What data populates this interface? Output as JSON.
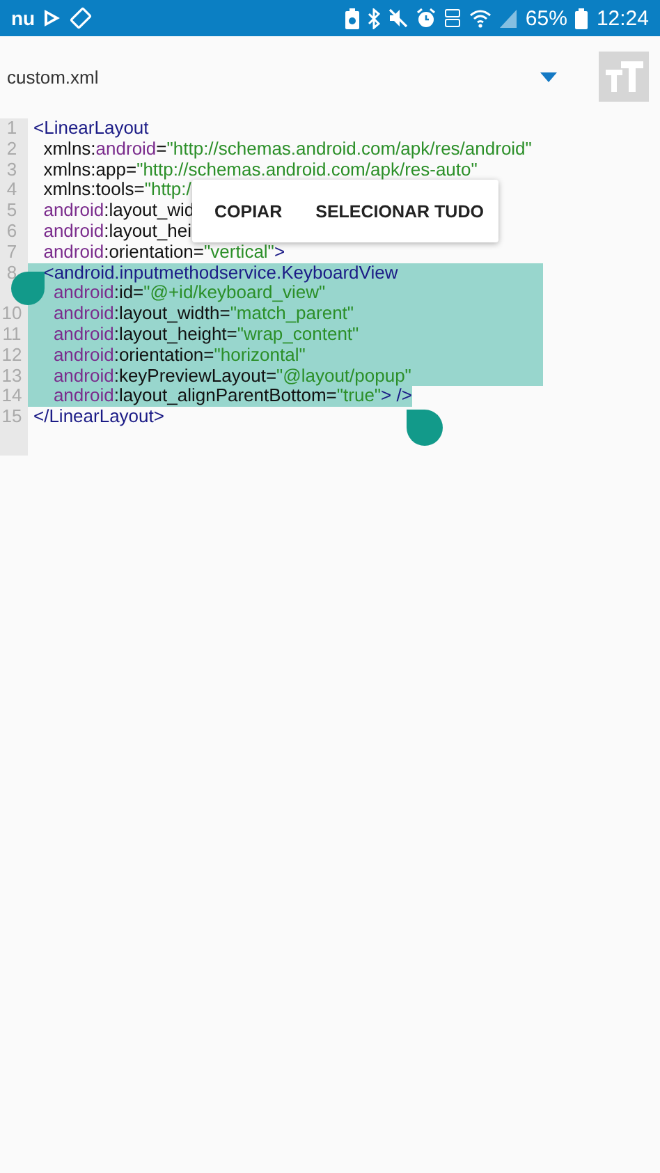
{
  "status_bar": {
    "app_badge": "nu",
    "battery_percent": "65%",
    "time": "12:24"
  },
  "toolbar": {
    "file_name": "custom.xml"
  },
  "editor": {
    "lines": [
      {
        "number": "1",
        "selected": false,
        "tokens": [
          {
            "kind": "tag",
            "text": "<LinearLayout"
          }
        ]
      },
      {
        "number": "2",
        "selected": false,
        "tokens": [
          {
            "kind": "plain",
            "text": "  xmlns:"
          },
          {
            "kind": "attr",
            "text": "android"
          },
          {
            "kind": "plain",
            "text": "="
          },
          {
            "kind": "string",
            "text": "\"http://schemas.android.com/apk/res/android\""
          }
        ]
      },
      {
        "number": "3",
        "selected": false,
        "tokens": [
          {
            "kind": "plain",
            "text": "  xmlns:app="
          },
          {
            "kind": "string",
            "text": "\"http://schemas.android.com/apk/res-auto\""
          }
        ]
      },
      {
        "number": "4",
        "selected": false,
        "tokens": [
          {
            "kind": "plain",
            "text": "  xmlns:tools="
          },
          {
            "kind": "string",
            "text": "\"http:/"
          }
        ]
      },
      {
        "number": "5",
        "selected": false,
        "tokens": [
          {
            "kind": "attr",
            "text": "  android"
          },
          {
            "kind": "plain",
            "text": ":layout_wid"
          }
        ]
      },
      {
        "number": "6",
        "selected": false,
        "tokens": [
          {
            "kind": "attr",
            "text": "  android"
          },
          {
            "kind": "plain",
            "text": ":layout_hei"
          }
        ]
      },
      {
        "number": "7",
        "selected": false,
        "tokens": [
          {
            "kind": "attr",
            "text": "  android"
          },
          {
            "kind": "plain",
            "text": ":orientation="
          },
          {
            "kind": "string",
            "text": "\"vertical\""
          },
          {
            "kind": "tag",
            "text": ">"
          }
        ]
      },
      {
        "number": "8",
        "selected": true,
        "tokens": [
          {
            "kind": "tag",
            "text": "  <android.inputmethodservice.KeyboardView"
          }
        ]
      },
      {
        "selected": true,
        "tokens": [
          {
            "kind": "attr",
            "text": "    android"
          },
          {
            "kind": "plain",
            "text": ":id="
          },
          {
            "kind": "string",
            "text": "\"@+id/keyboard_view\""
          }
        ]
      },
      {
        "number": "10",
        "selected": true,
        "tokens": [
          {
            "kind": "attr",
            "text": "    android"
          },
          {
            "kind": "plain",
            "text": ":layout_width="
          },
          {
            "kind": "string",
            "text": "\"match_parent\""
          }
        ]
      },
      {
        "number": "11",
        "selected": true,
        "tokens": [
          {
            "kind": "attr",
            "text": "    android"
          },
          {
            "kind": "plain",
            "text": ":layout_height="
          },
          {
            "kind": "string",
            "text": "\"wrap_content\""
          }
        ]
      },
      {
        "number": "12",
        "selected": true,
        "tokens": [
          {
            "kind": "attr",
            "text": "    android"
          },
          {
            "kind": "plain",
            "text": ":orientation="
          },
          {
            "kind": "string",
            "text": "\"horizontal\""
          }
        ]
      },
      {
        "number": "13",
        "selected": true,
        "tokens": [
          {
            "kind": "attr",
            "text": "    android"
          },
          {
            "kind": "plain",
            "text": ":keyPreviewLayout="
          },
          {
            "kind": "string",
            "text": "\"@layout/popup\""
          }
        ]
      },
      {
        "number": "14",
        "selected": true,
        "tokens": [
          {
            "kind": "attr",
            "text": "    android"
          },
          {
            "kind": "plain",
            "text": ":layout_alignParentBottom="
          },
          {
            "kind": "string",
            "text": "\"true\""
          },
          {
            "kind": "tag",
            "text": "> />"
          }
        ]
      },
      {
        "number": "15",
        "selected": false,
        "tokens": [
          {
            "kind": "tag",
            "text": "</LinearLayout>"
          }
        ]
      }
    ]
  },
  "context_menu": {
    "items": [
      "COPIAR",
      "SELECIONAR TUDO"
    ]
  }
}
